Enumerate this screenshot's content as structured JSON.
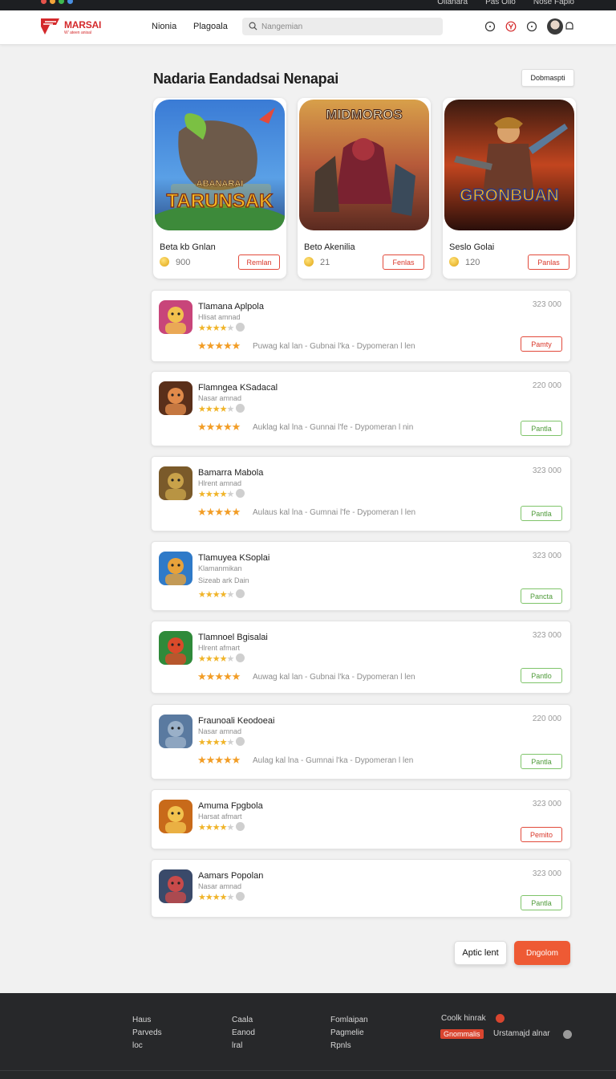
{
  "os_bar": {
    "right_items": [
      "Ollanara",
      "Pas Ollo",
      "Nose Fapio"
    ],
    "dot_colors": [
      "#e5534b",
      "#f2a43a",
      "#3fb950",
      "#4a90e2"
    ]
  },
  "header": {
    "brand": "MARSAI",
    "brand_tag": "W' ateen anisal",
    "nav": [
      "Nionia",
      "Plagoala"
    ],
    "search_placeholder": "Nangemian"
  },
  "main": {
    "title": "Nadaria Eandadsai Nenapai",
    "top_button": "Dobmaspti",
    "featured": [
      {
        "name": "Beta kb Gnlan",
        "price": "900",
        "button": "Remlan",
        "art_title": "TARUNSAK",
        "art_sub": "ABANARAI"
      },
      {
        "name": "Beto Akenilia",
        "price": "21",
        "button": "Fenlas",
        "art_title": "MIDMOROS",
        "art_sub": ""
      },
      {
        "name": "Seslo Golai",
        "price": "120",
        "button": "Panlas",
        "art_title": "GRONBUAN",
        "art_sub": ""
      }
    ],
    "rows": [
      {
        "name": "Tlamana Aplpola",
        "sub": "Hlisat amnad",
        "sub2": "",
        "size": "323 000",
        "meta": "Puwag kal lan - Gubnai l'ka - Dypomeran l len",
        "button": "Pamty",
        "button_style": "red",
        "stars_on": 4,
        "show_rating": true
      },
      {
        "name": "Flamngea KSadacal",
        "sub": "Nasar amnad",
        "sub2": "",
        "size": "220 000",
        "meta": "Auklag kal lna - Gunnai l'fe - Dypomeran l nin",
        "button": "Pantla",
        "button_style": "green",
        "stars_on": 4,
        "show_rating": true
      },
      {
        "name": "Bamarra Mabola",
        "sub": "Hlrent amnad",
        "sub2": "",
        "size": "323 000",
        "meta": "Aulaus kal lna - Gumnai l'fe - Dypomeran l len",
        "button": "Pantla",
        "button_style": "green",
        "stars_on": 4,
        "show_rating": true
      },
      {
        "name": "Tlamuyea KSoplai",
        "sub": "Klamanmikan",
        "sub2": "Sizeab ark Dain",
        "size": "323 000",
        "meta": "",
        "button": "Pancta",
        "button_style": "green",
        "stars_on": 4,
        "show_rating": false
      },
      {
        "name": "Tlamnoel Bgisalai",
        "sub": "Hlrent afmart",
        "sub2": "",
        "size": "323 000",
        "meta": "Auwag kal lan - Gubnai l'ka - Dypomeran l len",
        "button": "Pantlo",
        "button_style": "green",
        "stars_on": 4,
        "show_rating": true
      },
      {
        "name": "Fraunoali Keodoeai",
        "sub": "Nasar amnad",
        "sub2": "",
        "size": "220 000",
        "meta": "Aulag kal lna - Gumnai l'ka - Dypomeran l len",
        "button": "Pantla",
        "button_style": "green",
        "stars_on": 4,
        "show_rating": true
      },
      {
        "name": "Amuma Fpgbola",
        "sub": "Harsat afmart",
        "sub2": "",
        "size": "323 000",
        "meta": "",
        "button": "Pemito",
        "button_style": "red",
        "stars_on": 4,
        "show_rating": false
      },
      {
        "name": "Aamars Popolan",
        "sub": "Nasar amnad",
        "sub2": "",
        "size": "323 000",
        "meta": "",
        "button": "Pantla",
        "button_style": "green",
        "stars_on": 4,
        "show_rating": false
      }
    ],
    "buttons": {
      "secondary": "Aptic lent",
      "primary": "Dngolom"
    }
  },
  "footer": {
    "col1": [
      "Haus",
      "Parveds",
      "loc"
    ],
    "col2": [
      "Caala",
      "Eanod",
      "lral"
    ],
    "col3": [
      "Fomlaipan",
      "Pagmelie",
      "Rpnls"
    ],
    "right_title": "Coolk hinrak",
    "badge": "Gnommalis",
    "right_text": "Urstamajd alnar"
  },
  "colors": {
    "accent": "#ee5a34",
    "brand": "#d4292b",
    "green": "#4f9b3a"
  }
}
